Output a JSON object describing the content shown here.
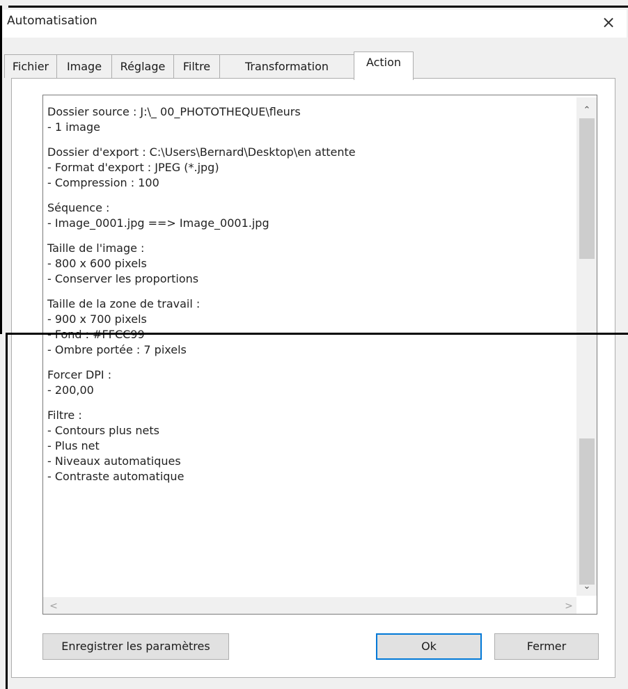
{
  "window": {
    "title": "Automatisation",
    "close_icon": "×"
  },
  "tabs": [
    {
      "label": "Fichier"
    },
    {
      "label": "Image"
    },
    {
      "label": "Réglage"
    },
    {
      "label": "Filtre"
    },
    {
      "label": "Transformation"
    },
    {
      "label": "Action",
      "active": true
    }
  ],
  "log": {
    "sections": [
      {
        "lines": [
          "Dossier source : J:\\_  00_PHOTOTHEQUE\\fleurs",
          "- 1 image"
        ]
      },
      {
        "lines": [
          "Dossier d'export : C:\\Users\\Bernard\\Desktop\\en attente",
          "- Format d'export : JPEG (*.jpg)",
          "- Compression : 100"
        ]
      },
      {
        "lines": [
          "Séquence :",
          "- Image_0001.jpg ==> Image_0001.jpg"
        ]
      },
      {
        "lines": [
          "Taille de l'image :",
          "- 800 x 600 pixels",
          "- Conserver les proportions"
        ]
      },
      {
        "lines": [
          "Taille de la zone de travail :",
          "- 900 x 700 pixels",
          "- Fond : #FFCC99",
          "- Ombre portée : 7 pixels"
        ]
      },
      {
        "lines": [
          "Forcer DPI :",
          "- 200,00"
        ]
      },
      {
        "lines": [
          "Filtre :",
          "- Contours plus nets",
          "- Plus net",
          "- Niveaux automatiques",
          "- Contraste automatique"
        ]
      }
    ]
  },
  "scrollbar": {
    "up_icon": "⌃",
    "down_icon": "⌄",
    "left_icon": "<",
    "right_icon": ">"
  },
  "buttons": {
    "save": "Enregistrer les paramètres",
    "ok": "Ok",
    "close": "Fermer"
  }
}
